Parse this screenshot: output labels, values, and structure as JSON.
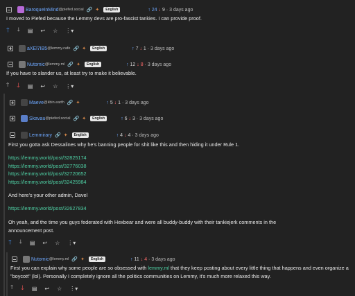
{
  "comments": [
    {
      "user": "BaroqueInMind",
      "instance": "@piefed.social",
      "lang": "English",
      "up": "24",
      "down": "9",
      "time": "3 days ago",
      "text": "I moved to Piefed because the Lemmy devs are pro-fascist tankies. I can provide proof."
    },
    {
      "user": "aXEl7IB5",
      "instance": "@lemmy.cafe",
      "lang": "English",
      "up": "7",
      "down": "1",
      "time": "3 days ago"
    },
    {
      "user": "Nutomic",
      "instance": "@lemmy.ml",
      "lang": "English",
      "up": "12",
      "down": "8",
      "time": "3 days ago",
      "text": "If you have to slander us, at least try to make it believable."
    },
    {
      "user": "Maeve",
      "instance": "@kbin.earth",
      "up": "5",
      "down": "1",
      "time": "3 days ago"
    },
    {
      "user": "Skavau",
      "instance": "@piefed.social",
      "lang": "English",
      "up": "6",
      "down": "3",
      "time": "3 days ago"
    },
    {
      "user": "Lemmirary",
      "lang": "English",
      "up": "4",
      "down": "4",
      "time": "3 days ago",
      "p1": "First you gotta ask Dessalines why he's banning people for shit like this and then hiding it under Rule 1.",
      "links1": [
        "https://lemmy.world/post/32825174",
        "https://lemmy.world/post/32776038",
        "https://lemmy.world/post/32720652",
        "https://lemmy.world/post/32425984"
      ],
      "p2": "And here's your other admin, Davel",
      "link2": "https://lemmy.world/post/32627834",
      "p3": "Oh yeah, and the time you guys federated with Hexbear and were all buddy-buddy with their tankiejerk comments in the announcement post."
    },
    {
      "user": "Nutomic",
      "instance": "@lemmy.ml",
      "lang": "English",
      "up": "11",
      "down": "4",
      "time": "3 days ago",
      "text_a": "First you can explain why some people are so obsessed with ",
      "text_link": "lemmy.ml",
      "text_b": " that they keep posting about every little thing that happens and even organize a \"boycott\" (lol). Personally I completely ignore all the politics communities on Lemmy, it's much more relaxed this way."
    }
  ],
  "icons": [
    "upvote-icon",
    "downvote-icon",
    "bookmark-icon",
    "reply-icon",
    "star-icon",
    "more-icon",
    "link-icon",
    "fediverse-icon"
  ],
  "colors": {
    "background": "#222222",
    "username": "#6ea8ff",
    "upvote": "#4c9bff",
    "downvote": "#ff5a5a",
    "link": "#4fd1a5"
  }
}
